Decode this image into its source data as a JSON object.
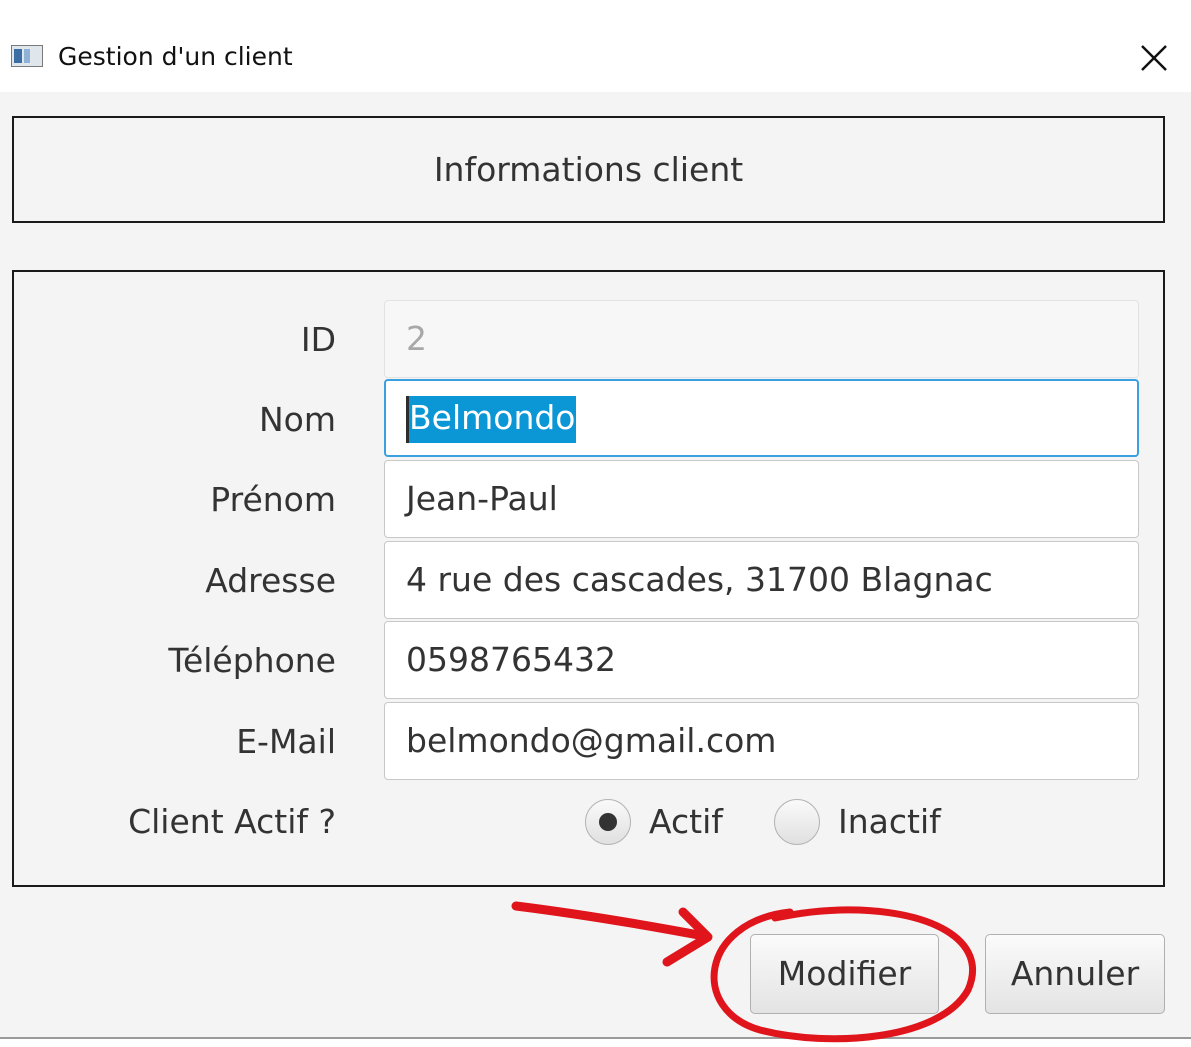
{
  "window": {
    "title": "Gestion d'un client",
    "icon": "app-window-icon",
    "close_icon": "close-icon"
  },
  "header": {
    "title": "Informations client"
  },
  "form": {
    "fields": [
      {
        "label": "ID",
        "value": "2",
        "editable": false
      },
      {
        "label": "Nom",
        "value": "Belmondo",
        "editable": true,
        "focused": true,
        "selected": true
      },
      {
        "label": "Prénom",
        "value": "Jean-Paul",
        "editable": true
      },
      {
        "label": "Adresse",
        "value": "4 rue des cascades, 31700 Blagnac",
        "editable": true
      },
      {
        "label": "Téléphone",
        "value": "0598765432",
        "editable": true
      },
      {
        "label": "E-Mail",
        "value": "belmondo@gmail.com",
        "editable": true
      }
    ],
    "status": {
      "label": "Client Actif ?",
      "options": [
        {
          "label": "Actif",
          "selected": true
        },
        {
          "label": "Inactif",
          "selected": false
        }
      ]
    }
  },
  "buttons": {
    "modify": "Modifier",
    "cancel": "Annuler"
  },
  "colors": {
    "selection": "#0b96d6",
    "focus_border": "#3aa0e0",
    "annotation": "#e0141b",
    "background": "#f4f4f4"
  }
}
